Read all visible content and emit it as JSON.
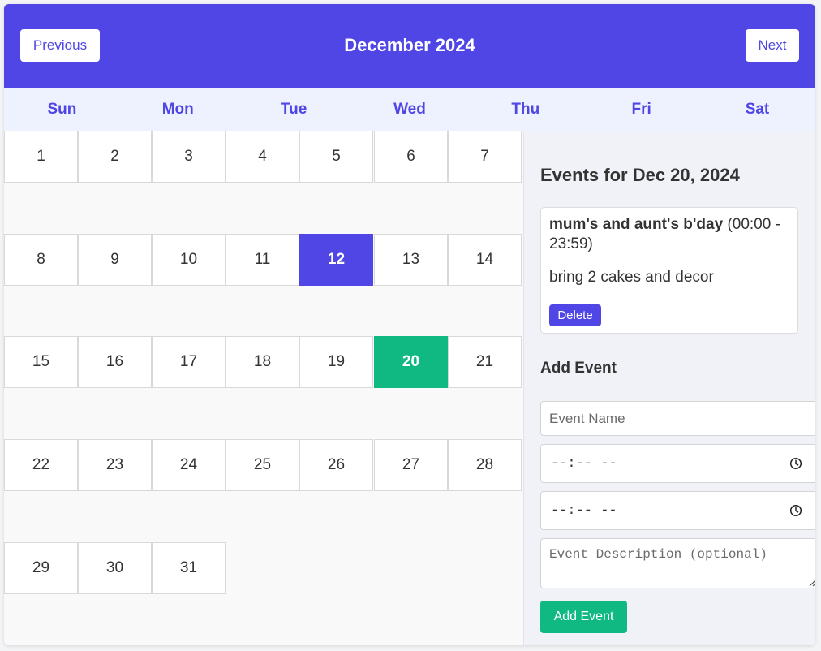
{
  "header": {
    "prev_label": "Previous",
    "next_label": "Next",
    "month_title": "December 2024",
    "bg_color": "#4f46e5"
  },
  "weekdays": [
    "Sun",
    "Mon",
    "Tue",
    "Wed",
    "Thu",
    "Fri",
    "Sat"
  ],
  "calendar": {
    "days": [
      "1",
      "2",
      "3",
      "4",
      "5",
      "6",
      "7",
      "8",
      "9",
      "10",
      "11",
      "12",
      "13",
      "14",
      "15",
      "16",
      "17",
      "18",
      "19",
      "20",
      "21",
      "22",
      "23",
      "24",
      "25",
      "26",
      "27",
      "28",
      "29",
      "30",
      "31"
    ],
    "today": "12",
    "selected": "20",
    "today_color": "#4f46e5",
    "selected_color": "#10b981"
  },
  "events_panel": {
    "title": "Events for Dec 20, 2024",
    "events": [
      {
        "name": "mum's and aunt's b'day",
        "time": "(00:00 - 23:59)",
        "description": "bring 2 cakes and decor",
        "delete_label": "Delete"
      }
    ]
  },
  "add_form": {
    "title": "Add Event",
    "name_placeholder": "Event Name",
    "start_time_placeholder": "--:-- --",
    "end_time_placeholder": "--:-- --",
    "clock_icon": "clock-icon",
    "description_placeholder": "Event Description (optional)",
    "submit_label": "Add Event"
  }
}
